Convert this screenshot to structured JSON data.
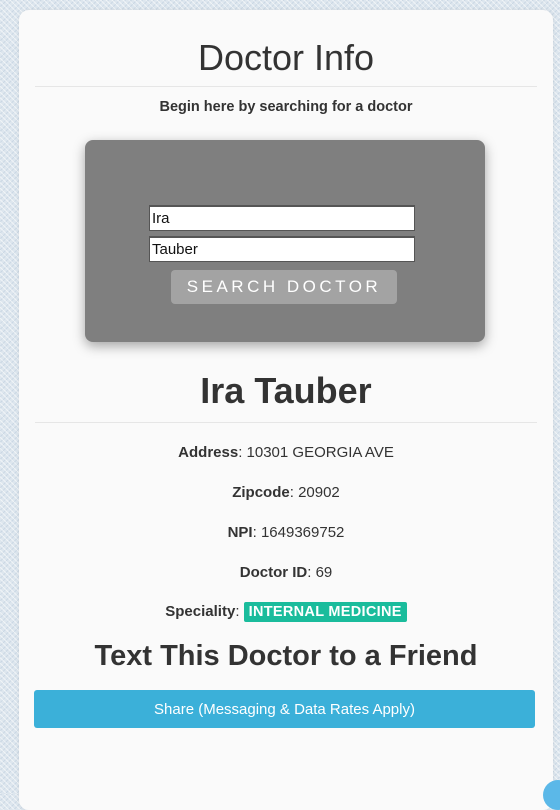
{
  "header": {
    "title": "Doctor Info",
    "subtitle": "Begin here by searching for a doctor"
  },
  "search": {
    "first_name_value": "Ira",
    "last_name_value": "Tauber",
    "button_label": "SEARCH DOCTOR"
  },
  "doctor": {
    "name": "Ira Tauber",
    "address_label": "Address",
    "address": "10301 GEORGIA AVE",
    "zipcode_label": "Zipcode",
    "zipcode": "20902",
    "npi_label": "NPI",
    "npi": "1649369752",
    "id_label": "Doctor ID",
    "id": "69",
    "speciality_label": "Speciality",
    "speciality": "INTERNAL MEDICINE"
  },
  "share": {
    "title": "Text This Doctor to a Friend",
    "button_label": "Share (Messaging & Data Rates Apply)"
  },
  "colors": {
    "badge": "#1abc9c",
    "share_button": "#3bb0d9",
    "search_panel": "#7f7f7f"
  }
}
